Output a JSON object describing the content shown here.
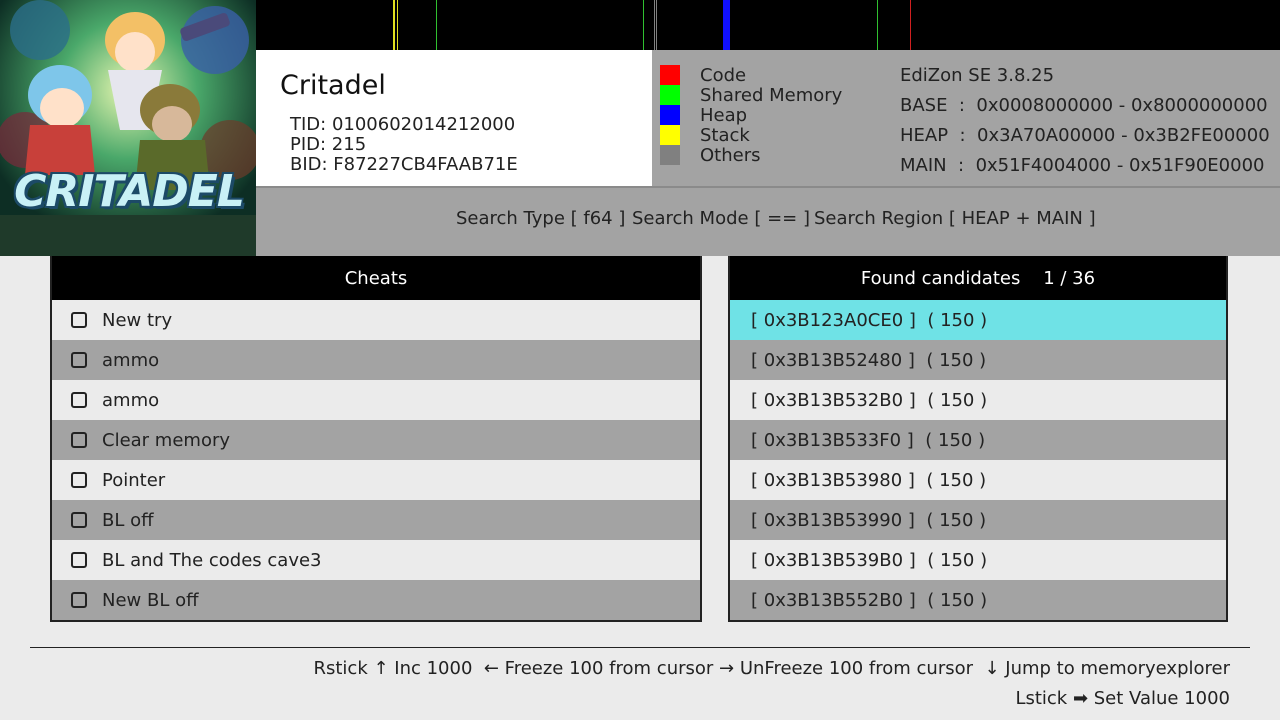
{
  "game": {
    "title": "Critadel",
    "tid": "TID: 0100602014212000",
    "pid": "PID: 215",
    "bid": "BID: F87227CB4FAAB71E",
    "logo_text": "CRITADEL"
  },
  "legend": [
    {
      "label": "Code",
      "color": "#ff0000"
    },
    {
      "label": "Shared Memory",
      "color": "#00ff00"
    },
    {
      "label": "Heap",
      "color": "#0000ff"
    },
    {
      "label": "Stack",
      "color": "#ffff00"
    },
    {
      "label": "Others",
      "color": "#808080"
    }
  ],
  "memory_info": {
    "version": "EdiZon SE 3.8.25",
    "base": "BASE  :  0x0008000000 - 0x8000000000",
    "heap": "HEAP  :  0x3A70A00000 - 0x3B2FE00000",
    "main": "MAIN  :  0x51F4004000 - 0x51F90E0000"
  },
  "search": {
    "type": "Search Type [ f64 ]",
    "mode": "Search Mode [ == ]",
    "region": "Search Region [ HEAP + MAIN ]"
  },
  "cheats": {
    "header": "Cheats",
    "items": [
      "New try",
      "ammo",
      "ammo",
      "Clear memory",
      "Pointer",
      "BL off",
      "BL and The codes cave3",
      "New BL off"
    ]
  },
  "candidates": {
    "header": "Found candidates    1 / 36",
    "selected_index": 0,
    "items": [
      "[ 0x3B123A0CE0 ]  ( 150 )",
      "[ 0x3B13B52480 ]  ( 150 )",
      "[ 0x3B13B532B0 ]  ( 150 )",
      "[ 0x3B13B533F0 ]  ( 150 )",
      "[ 0x3B13B53980 ]  ( 150 )",
      "[ 0x3B13B53990 ]  ( 150 )",
      "[ 0x3B13B539B0 ]  ( 150 )",
      "[ 0x3B13B552B0 ]  ( 150 )"
    ]
  },
  "footer": {
    "line1": "Rstick ↑ Inc 1000  ← Freeze 100 from cursor → UnFreeze 100 from cursor  ↓ Jump to memoryexplorer",
    "line2": "Lstick ➡ Set Value 1000"
  },
  "memory_bar": [
    {
      "type": "yellow",
      "color": "#e0e020"
    },
    {
      "type": "yellow",
      "color": "#e0e020"
    },
    {
      "type": "green",
      "color": "#30c030"
    },
    {
      "type": "green",
      "color": "#30c030"
    },
    {
      "type": "gray",
      "color": "#808080"
    },
    {
      "type": "gray",
      "color": "#808080"
    },
    {
      "type": "blue",
      "color": "#1010ff"
    },
    {
      "type": "green",
      "color": "#30c030"
    },
    {
      "type": "red",
      "color": "#d02020"
    }
  ]
}
